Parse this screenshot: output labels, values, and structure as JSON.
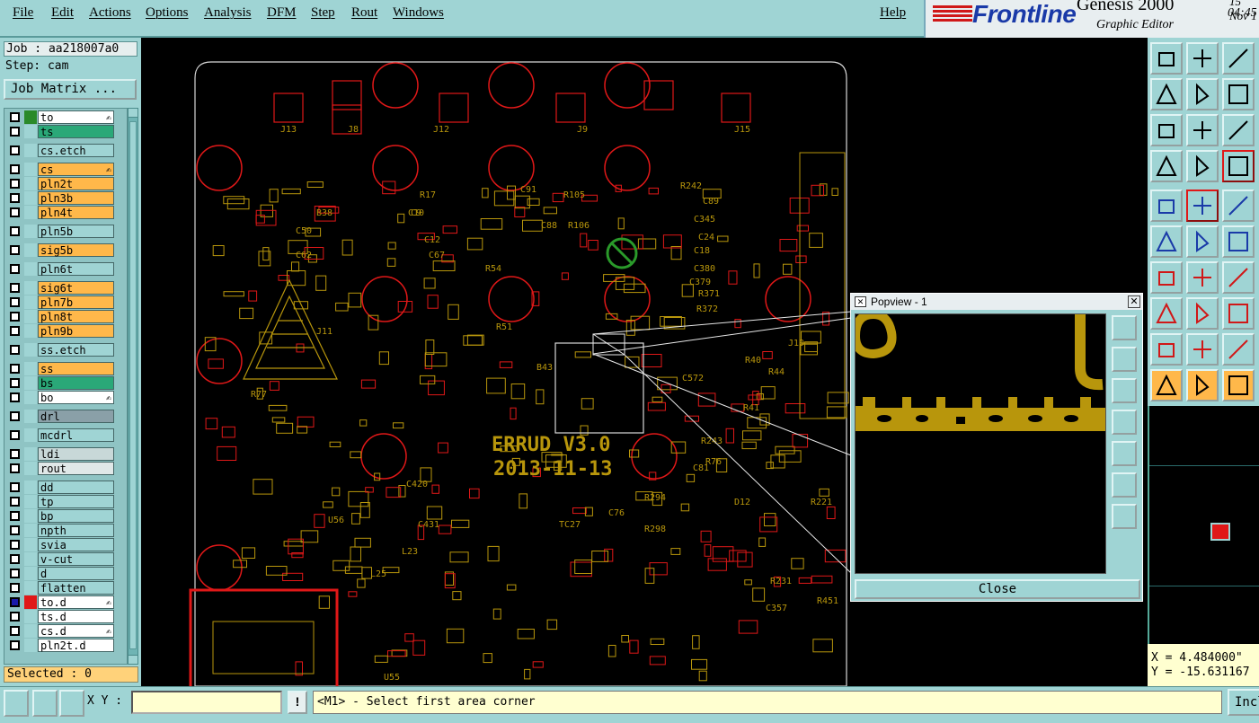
{
  "menu": {
    "items": [
      "File",
      "Edit",
      "Actions",
      "Options",
      "Analysis",
      "DFM",
      "Step",
      "Rout",
      "Windows"
    ],
    "help": "Help"
  },
  "brand": {
    "logo": "Frontline",
    "product": "Genesis 2000",
    "subtitle": "Graphic Editor",
    "date": "15 Nov 1",
    "time": "04:45"
  },
  "job": {
    "job_label": "Job : aa218007a0",
    "step_label": "Step: cam",
    "matrix_button": "Job Matrix ..."
  },
  "layers": [
    {
      "name": "to",
      "color": "#2a8a2a",
      "bg": "#ffffff",
      "edit": true
    },
    {
      "name": "ts",
      "color": "#9fd4d4",
      "bg": "#2aa878",
      "edit": false
    },
    {
      "name": "cs.etch",
      "color": "#9fd4d4",
      "bg": "#9fd4d4",
      "edit": false,
      "gap": true
    },
    {
      "name": "cs",
      "color": "#9fd4d4",
      "bg": "#ffb84a",
      "edit": true,
      "gap": true
    },
    {
      "name": "pln2t",
      "color": "#9fd4d4",
      "bg": "#ffb84a",
      "edit": false
    },
    {
      "name": "pln3b",
      "color": "#9fd4d4",
      "bg": "#ffb84a",
      "edit": false
    },
    {
      "name": "pln4t",
      "color": "#9fd4d4",
      "bg": "#ffb84a",
      "edit": false
    },
    {
      "name": "pln5b",
      "color": "#9fd4d4",
      "bg": "#9fd4d4",
      "edit": false,
      "gap": true
    },
    {
      "name": "sig5b",
      "color": "#9fd4d4",
      "bg": "#ffb84a",
      "edit": false,
      "gap": true
    },
    {
      "name": "pln6t",
      "color": "#9fd4d4",
      "bg": "#9fd4d4",
      "edit": false,
      "gap": true
    },
    {
      "name": "sig6t",
      "color": "#9fd4d4",
      "bg": "#ffb84a",
      "edit": false,
      "gap": true
    },
    {
      "name": "pln7b",
      "color": "#9fd4d4",
      "bg": "#ffb84a",
      "edit": false
    },
    {
      "name": "pln8t",
      "color": "#9fd4d4",
      "bg": "#ffb84a",
      "edit": false
    },
    {
      "name": "pln9b",
      "color": "#9fd4d4",
      "bg": "#ffb84a",
      "edit": false
    },
    {
      "name": "ss.etch",
      "color": "#9fd4d4",
      "bg": "#9fd4d4",
      "edit": false,
      "gap": true
    },
    {
      "name": "ss",
      "color": "#9fd4d4",
      "bg": "#ffb84a",
      "edit": false,
      "gap": true
    },
    {
      "name": "bs",
      "color": "#9fd4d4",
      "bg": "#2aa878",
      "edit": false
    },
    {
      "name": "bo",
      "color": "#9fd4d4",
      "bg": "#ffffff",
      "edit": true
    },
    {
      "name": "drl",
      "color": "#9fd4d4",
      "bg": "#8aa0a8",
      "edit": false,
      "gap": true
    },
    {
      "name": "mcdrl",
      "color": "#9fd4d4",
      "bg": "#9fd4d4",
      "edit": false,
      "gap": true
    },
    {
      "name": "ldi",
      "color": "#9fd4d4",
      "bg": "#c8d8d8",
      "edit": false,
      "gap": true
    },
    {
      "name": "rout",
      "color": "#9fd4d4",
      "bg": "#e0e8e8",
      "edit": false
    },
    {
      "name": "dd",
      "color": "#9fd4d4",
      "bg": "#9fd4d4",
      "edit": false,
      "gap": true
    },
    {
      "name": "tp",
      "color": "#9fd4d4",
      "bg": "#9fd4d4",
      "edit": false
    },
    {
      "name": "bp",
      "color": "#9fd4d4",
      "bg": "#9fd4d4",
      "edit": false
    },
    {
      "name": "npth",
      "color": "#9fd4d4",
      "bg": "#9fd4d4",
      "edit": false
    },
    {
      "name": "svia",
      "color": "#9fd4d4",
      "bg": "#9fd4d4",
      "edit": false
    },
    {
      "name": "v-cut",
      "color": "#9fd4d4",
      "bg": "#9fd4d4",
      "edit": false
    },
    {
      "name": "d",
      "color": "#9fd4d4",
      "bg": "#9fd4d4",
      "edit": false
    },
    {
      "name": "flatten",
      "color": "#9fd4d4",
      "bg": "#9fd4d4",
      "edit": false
    },
    {
      "name": "to.d",
      "color": "#e01818",
      "bg": "#ffffff",
      "edit": true,
      "checked": true
    },
    {
      "name": "ts.d",
      "color": "#9fd4d4",
      "bg": "#ffffff",
      "edit": false
    },
    {
      "name": "cs.d",
      "color": "#9fd4d4",
      "bg": "#ffffff",
      "edit": true
    },
    {
      "name": "pln2t.d",
      "color": "#9fd4d4",
      "bg": "#ffffff",
      "edit": false
    }
  ],
  "selected": "Selected : 0",
  "board": {
    "silk_title": "ERRUD_V3.0",
    "silk_date": "2013-11-13",
    "labels": [
      "J13",
      "J8",
      "J12",
      "J9",
      "J15",
      "R17",
      "R106",
      "R105",
      "R51",
      "B43",
      "R294",
      "R298",
      "R243",
      "R76",
      "R40",
      "R44",
      "R41",
      "R221",
      "D12",
      "TC27",
      "C420",
      "C431",
      "U56",
      "L23",
      "L25",
      "U55",
      "C81",
      "C76",
      "R77",
      "B38",
      "C89",
      "C345",
      "C24",
      "C18",
      "C380",
      "C379",
      "C9",
      "C12",
      "C67",
      "C50",
      "C62",
      "C572",
      "R371",
      "R372",
      "J11",
      "J19",
      "R231",
      "C357",
      "R451",
      "C10",
      "R242",
      "C91",
      "C88",
      "R54"
    ],
    "accent_copper": "#b8960c",
    "accent_outline": "#e01818"
  },
  "popview": {
    "title": "Popview - 1",
    "close_button": "Close"
  },
  "coords": {
    "x": "X = 4.484000\"",
    "y": "Y = -15.631167"
  },
  "bottom": {
    "xy_label": "X Y :",
    "xy_value": "",
    "status": "<M1> - Select first area corner",
    "incl": "Incl"
  }
}
